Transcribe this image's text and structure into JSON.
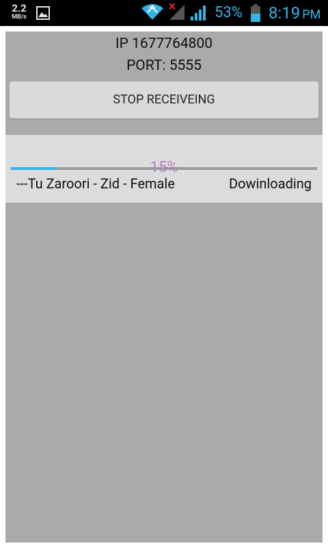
{
  "status_bar": {
    "net_speed_value": "2.2",
    "net_speed_unit": "MB/s",
    "battery_percent": "53%",
    "time": "8:19",
    "ampm": "PM",
    "icons": [
      "gallery-icon",
      "wifi-icon",
      "signal-no-sim-icon",
      "signal-icon",
      "battery-icon"
    ],
    "accent_color": "#33b5e5"
  },
  "main": {
    "ip_text": "IP 1677764800",
    "port_text": "PORT: 5555",
    "stop_button_label": "STOP RECEIVEING"
  },
  "transfer": {
    "progress_label": "15%",
    "progress_value": 0.15,
    "song_name": "---Tu Zaroori - Zid - Female",
    "status": "Dowinloading"
  },
  "colors": {
    "app_background": "#aaaaaa",
    "panel_background": "#dcdcdc",
    "progress_fill": "#33b5e5",
    "progress_text": "#b46ec8"
  }
}
